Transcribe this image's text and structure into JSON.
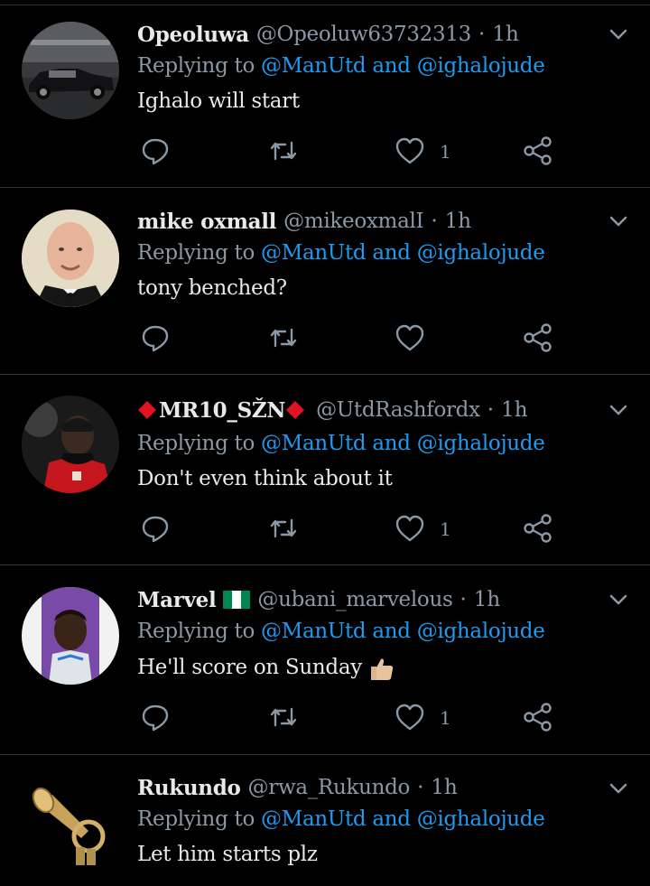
{
  "colors": {
    "background": "#000000",
    "divider": "#2f3336",
    "name": "#e7e9ea",
    "muted": "#8b98a5",
    "mention": "#1d9bf0"
  },
  "tweets": [
    {
      "name": "Opeoluwa",
      "handle": "@Opeoluw63732313",
      "time": "1h",
      "replying_prefix": "Replying to",
      "mention1": "@ManUtd",
      "and": "and",
      "mention2": "@ighalojude",
      "text": "Ighalo will start",
      "like_count": "1",
      "avatar_icon": "vintage-car-avatar"
    },
    {
      "name": "mike oxmall",
      "handle": "@mikeoxmalI",
      "time": "1h",
      "replying_prefix": "Replying to",
      "mention1": "@ManUtd",
      "and": "and",
      "mention2": "@ighalojude",
      "text": "tony benched?",
      "like_count": "",
      "avatar_icon": "bald-man-avatar"
    },
    {
      "name": "MR10_SŽN",
      "handle": "@UtdRashfordx",
      "time": "1h",
      "replying_prefix": "Replying to",
      "mention1": "@ManUtd",
      "and": "and",
      "mention2": "@ighalojude",
      "text": "Don't even think about it",
      "like_count": "1",
      "avatar_icon": "footballer-avatar"
    },
    {
      "name": "Marvel",
      "handle": "@ubani_marvelous",
      "time": "1h",
      "replying_prefix": "Replying to",
      "mention1": "@ManUtd",
      "and": "and",
      "mention2": "@ighalojude",
      "text": "He'll score on Sunday",
      "like_count": "1",
      "avatar_icon": "selfie-avatar"
    },
    {
      "name": "Rukundo",
      "handle": "@rwa_Rukundo",
      "time": "1h",
      "replying_prefix": "Replying to",
      "mention1": "@ManUtd",
      "and": "and",
      "mention2": "@ighalojude",
      "text": "Let him starts plz",
      "like_count": "",
      "avatar_icon": "trumpet-avatar"
    }
  ],
  "icons": {
    "reply": "reply-icon",
    "retweet": "retweet-icon",
    "like": "like-icon",
    "share": "share-icon",
    "more": "chevron-down-icon"
  }
}
